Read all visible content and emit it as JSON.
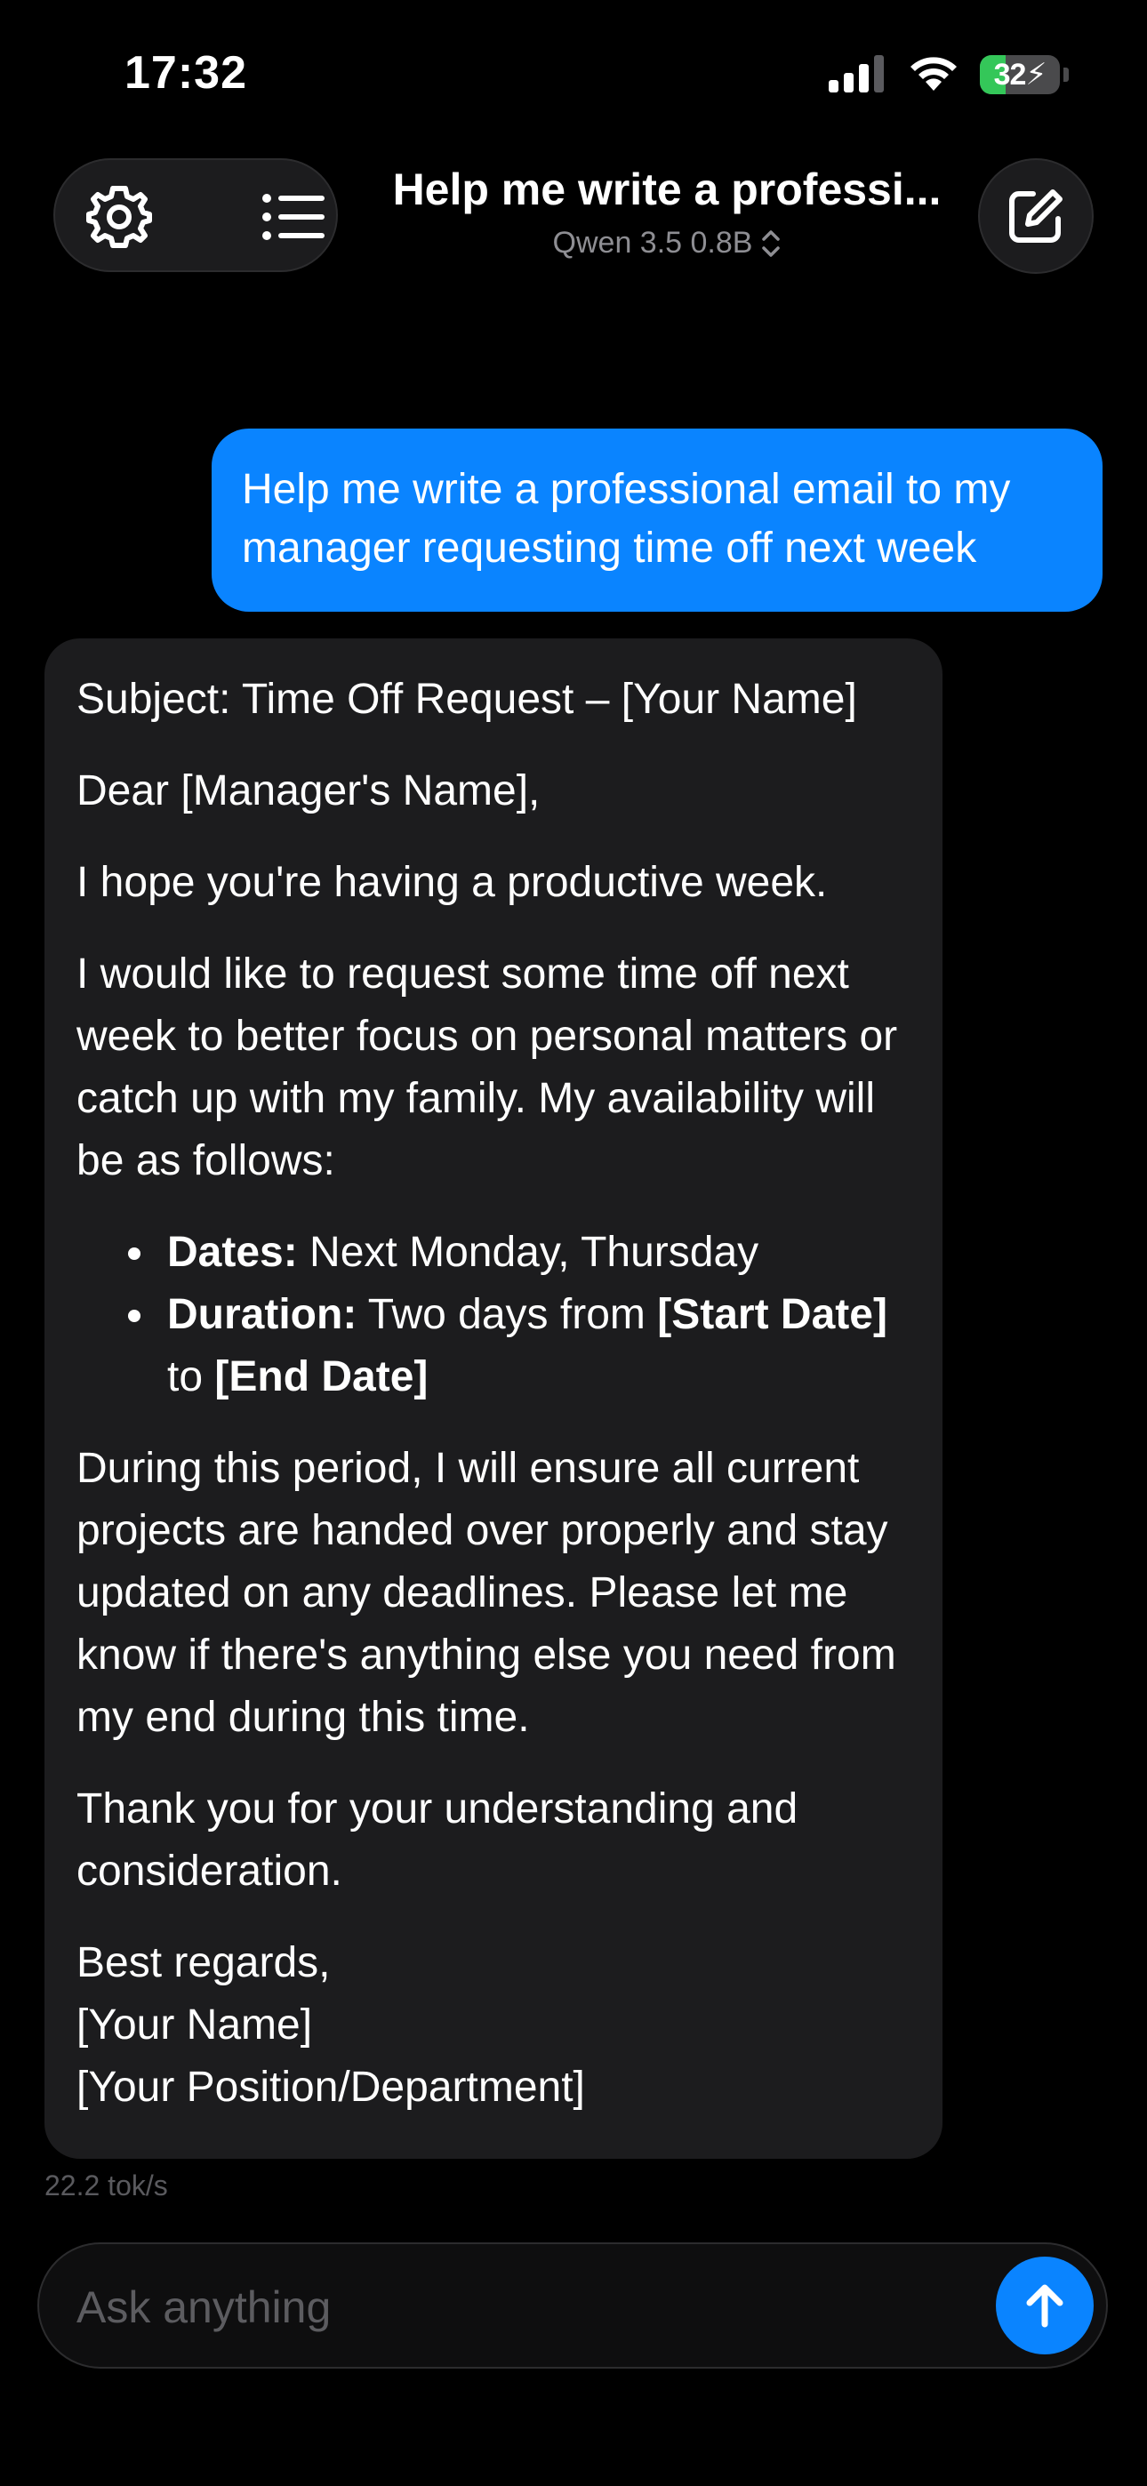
{
  "status_bar": {
    "time": "17:32",
    "battery_level": "32",
    "battery_fraction": 0.32,
    "battery_color": "#34c759",
    "icons": [
      "signal-icon",
      "wifi-icon",
      "battery-charging-icon"
    ]
  },
  "header": {
    "title": "Help me write a professi...",
    "model_label": "Qwen 3.5 0.8B",
    "icons": [
      "gear-icon",
      "list-icon",
      "chevron-up-down-icon",
      "compose-icon"
    ]
  },
  "conversation": {
    "user_message": "Help me write a professional email to my manager requesting time off next week",
    "assistant": {
      "subject": "Subject: Time Off Request – [Your Name]",
      "greeting": "Dear [Manager's Name],",
      "p1": "I hope you're having a productive week.",
      "p2": "I would like to request some time off next week to better focus on personal matters or catch up with my family. My availability will be as follows:",
      "bullet1_label": "Dates:",
      "bullet1_text": " Next Monday, Thursday",
      "bullet2_label": "Duration:",
      "bullet2_text": " Two days from ",
      "bullet2_start": "[Start Date]",
      "bullet2_to": " to ",
      "bullet2_end": "[End Date]",
      "p3": "During this period, I will ensure all current projects are handed over properly and stay updated on any deadlines. Please let me know if there's anything else you need from my end during this time.",
      "p4": "Thank you for your understanding and consideration.",
      "closing": "Best regards,",
      "sig_name": "[Your Name]",
      "sig_position": "[Your Position/Department]"
    },
    "token_rate": "22.2 tok/s"
  },
  "composer": {
    "placeholder": "Ask anything",
    "value": "",
    "send_icon": "arrow-up-icon",
    "accent_color": "#0a84ff"
  }
}
